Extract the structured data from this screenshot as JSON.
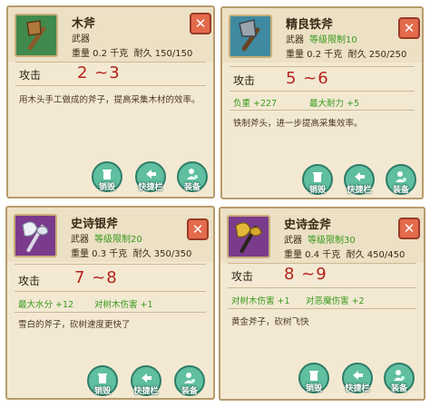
{
  "cards": [
    {
      "name": "木斧",
      "category": "武器",
      "level": "",
      "weight": "重量 0.2 千克",
      "durability": "耐久 150/150",
      "attack_label": "攻击",
      "attack_value": "2 ~3",
      "bonuses": [],
      "description": "用木头手工做成的斧子，提高采集木材的效率。",
      "buttons": [
        "销毁",
        "快捷栏",
        "装备"
      ],
      "close": "✕"
    },
    {
      "name": "精良铁斧",
      "category": "武器",
      "level": "等级限制10",
      "weight": "重量 0.2 千克",
      "durability": "耐久 250/250",
      "attack_label": "攻击",
      "attack_value": "5 ~6",
      "bonuses": [
        "负重 +227",
        "最大耐力 +5"
      ],
      "description": "铁制斧头，进一步提高采集效率。",
      "buttons": [
        "销毁",
        "快捷栏",
        "装备"
      ],
      "close": "✕"
    },
    {
      "name": "史诗银斧",
      "category": "武器",
      "level": "等级限制20",
      "weight": "重量 0.3 千克",
      "durability": "耐久 350/350",
      "attack_label": "攻击",
      "attack_value": "7 ~8",
      "bonuses": [
        "最大水分 +12",
        "对树木伤害 +1"
      ],
      "description": "雪白的斧子，砍树速度更快了",
      "buttons": [
        "销毁",
        "快捷栏",
        "装备"
      ],
      "close": "✕"
    },
    {
      "name": "史诗金斧",
      "category": "武器",
      "level": "等级限制30",
      "weight": "重量 0.4 千克",
      "durability": "耐久 450/450",
      "attack_label": "攻击",
      "attack_value": "8 ~9",
      "bonuses": [
        "对树木伤害 +1",
        "对恶魔伤害 +2"
      ],
      "description": "黄金斧子，砍树飞快",
      "buttons": [
        "销毁",
        "快捷栏",
        "装备"
      ],
      "close": "✕"
    }
  ],
  "colors": {
    "panel": "#f3e9d3",
    "border": "#b89b6c",
    "attack": "#b4231d",
    "bonus": "#3a9a1e",
    "button": "#5fbfa0",
    "close": "#e46a4c"
  },
  "icons": [
    "wooden-axe-icon",
    "iron-axe-icon",
    "silver-axe-icon",
    "golden-axe-icon",
    "trash-icon",
    "arrow-icon",
    "person-gear-icon"
  ]
}
